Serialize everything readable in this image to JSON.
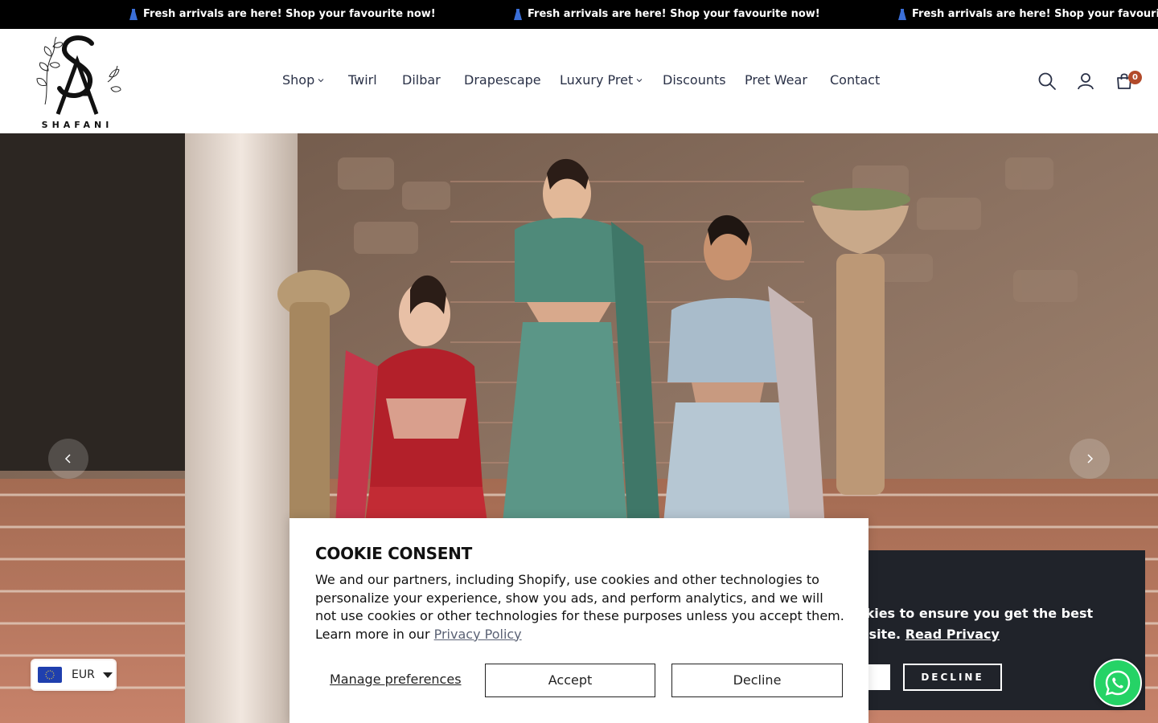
{
  "announcement": {
    "items": [
      "Fresh arrivals are here! Shop your favourite now!",
      "Fresh arrivals are here! Shop your favourite now!",
      "Fresh arrivals are here! Shop your favourite now!"
    ],
    "icon": "dress-icon"
  },
  "brand": {
    "logo_text": "SHAFANI",
    "monogram": "SA"
  },
  "nav": {
    "items": [
      {
        "label": "Shop",
        "has_dropdown": true
      },
      {
        "label": "Twirl",
        "has_dropdown": false
      },
      {
        "label": "Dilbar",
        "has_dropdown": false
      },
      {
        "label": "Drapescape",
        "has_dropdown": false
      },
      {
        "label": "Luxury Pret",
        "has_dropdown": true
      },
      {
        "label": "Discounts",
        "has_dropdown": false
      },
      {
        "label": "Pret Wear",
        "has_dropdown": false
      },
      {
        "label": "Contact",
        "has_dropdown": false
      }
    ]
  },
  "header_icons": {
    "search": "search-icon",
    "account": "user-icon",
    "cart": "cart-icon",
    "cart_count": "0"
  },
  "hero": {
    "prev": "chevron-left-icon",
    "next": "chevron-right-icon"
  },
  "currency": {
    "code": "EUR",
    "flag": "eu-flag-icon"
  },
  "dark_cookie": {
    "text": "s cookies to ensure you get the best r website.",
    "link": "Read Privacy",
    "decline": "DECLINE"
  },
  "cookie": {
    "title": "COOKIE CONSENT",
    "body": "We and our partners, including Shopify, use cookies and other technologies to personalize your experience, show you ads, and perform analytics, and we will not use cookies or other technologies for these purposes unless you accept them. Learn more in our",
    "link": "Privacy Policy",
    "manage": "Manage preferences",
    "accept": "Accept",
    "decline": "Decline"
  },
  "colors": {
    "announcement_bg": "#000000",
    "nav_text": "#2a3147",
    "cart_badge": "#b24a2a",
    "dark_cookie_bg": "#20232a",
    "whatsapp": "#25d366"
  }
}
